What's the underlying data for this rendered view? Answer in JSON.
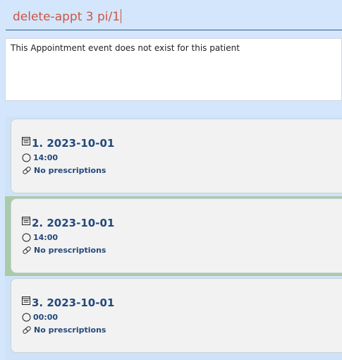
{
  "command": {
    "value": "delete-appt 3 pi/1"
  },
  "result": {
    "message": "This Appointment event does not exist for this patient"
  },
  "appointments": [
    {
      "index": "1.",
      "date": "2023-10-01",
      "time": "14:00",
      "prescriptions": "No prescriptions",
      "selected": false
    },
    {
      "index": "2.",
      "date": "2023-10-01",
      "time": "14:00",
      "prescriptions": "No prescriptions",
      "selected": true
    },
    {
      "index": "3.",
      "date": "2023-10-01",
      "time": "00:00",
      "prescriptions": "No prescriptions",
      "selected": false
    }
  ],
  "icons": {
    "date": "calendar-icon",
    "time": "clock-icon",
    "prescriptions": "pill-icon"
  },
  "colors": {
    "accent_text": "#24497a",
    "command_text": "#cc5544",
    "selected_row": "#a9cba7"
  }
}
